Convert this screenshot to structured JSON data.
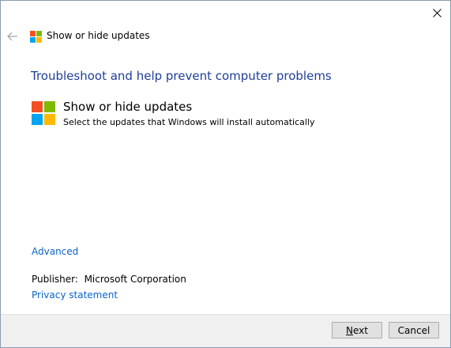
{
  "window": {
    "close_icon": "close-icon"
  },
  "header": {
    "back_icon": "back-arrow-icon",
    "logo_icon": "windows-logo-icon",
    "title": "Show or hide updates"
  },
  "main": {
    "heading": "Troubleshoot and help prevent computer problems",
    "option": {
      "icon": "windows-logo-icon",
      "title": "Show or hide updates",
      "description": "Select the updates that Windows will install automatically"
    },
    "advanced_link": "Advanced",
    "publisher_label": "Publisher:",
    "publisher_value": "Microsoft Corporation",
    "privacy_link": "Privacy statement"
  },
  "footer": {
    "next_first": "N",
    "next_rest": "ext",
    "cancel_label": "Cancel"
  },
  "colors": {
    "heading": "#1e3f99",
    "link": "#0a63c9",
    "logo_red": "#f25022",
    "logo_green": "#7fba00",
    "logo_blue": "#00a4ef",
    "logo_yellow": "#ffb900"
  }
}
